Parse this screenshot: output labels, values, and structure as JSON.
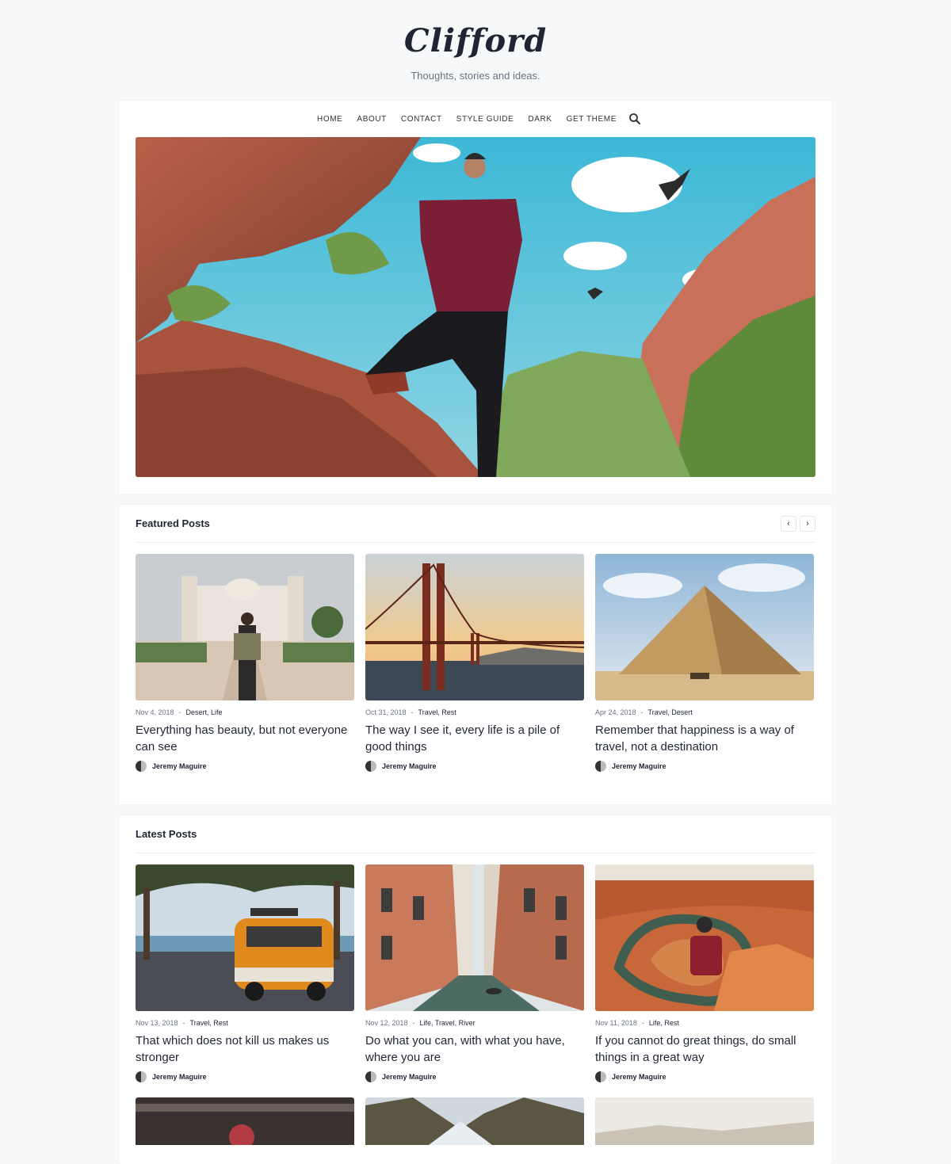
{
  "site": {
    "logo": "Clifford",
    "tagline": "Thoughts, stories and ideas."
  },
  "nav": {
    "items": [
      "HOME",
      "ABOUT",
      "CONTACT",
      "STYLE GUIDE",
      "DARK",
      "GET THEME"
    ],
    "search_icon": "search-icon"
  },
  "featured": {
    "title": "Featured Posts",
    "prev_icon": "chevron-left-icon",
    "next_icon": "chevron-right-icon",
    "posts": [
      {
        "date": "Nov 4, 2018",
        "tags": "Desert, Life",
        "title": "Everything has beauty, but not everyone can see",
        "author": "Jeremy Maguire",
        "image": "palace-traveler-photo"
      },
      {
        "date": "Oct 31, 2018",
        "tags": "Travel, Rest",
        "title": "The way I see it, every life is a pile of good things",
        "author": "Jeremy Maguire",
        "image": "golden-gate-bridge-photo"
      },
      {
        "date": "Apr 24, 2018",
        "tags": "Travel, Desert",
        "title": "Remember that happiness is a way of travel, not a destination",
        "author": "Jeremy Maguire",
        "image": "pyramid-photo"
      }
    ]
  },
  "latest": {
    "title": "Latest Posts",
    "posts": [
      {
        "date": "Nov 13, 2018",
        "tags": "Travel, Rest",
        "title": "That which does not kill us makes us stronger",
        "author": "Jeremy Maguire",
        "image": "orange-van-photo"
      },
      {
        "date": "Nov 12, 2018",
        "tags": "Life, Travel, River",
        "title": "Do what you can, with what you have, where you are",
        "author": "Jeremy Maguire",
        "image": "venice-canal-photo"
      },
      {
        "date": "Nov 11, 2018",
        "tags": "Life, Rest",
        "title": "If you cannot do great things, do small things in a great way",
        "author": "Jeremy Maguire",
        "image": "canyon-horseshoe-photo"
      }
    ]
  }
}
